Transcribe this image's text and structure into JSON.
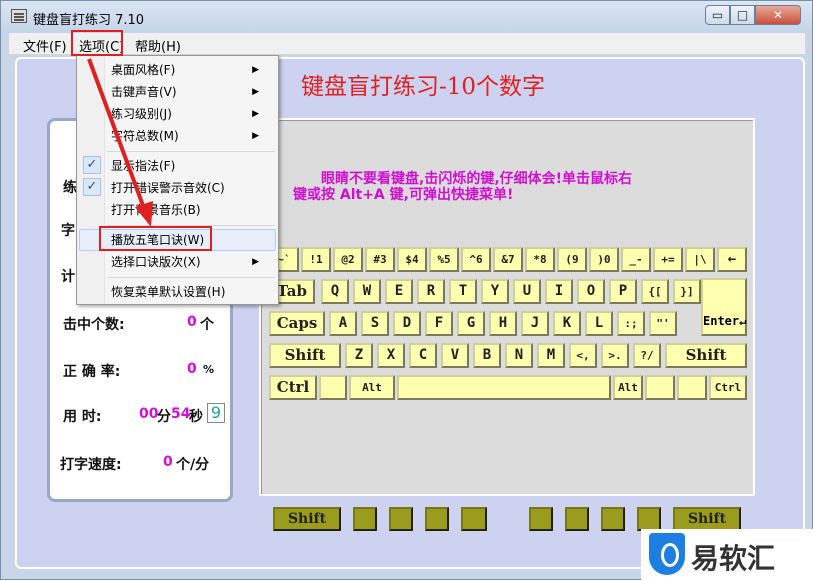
{
  "window": {
    "title": "键盘盲打练习 7.10",
    "controls": {
      "minimize": "▭",
      "maximize": "□",
      "close": "✕"
    }
  },
  "menubar": {
    "items": [
      {
        "label": "文件(F)"
      },
      {
        "label": "选项(C)"
      },
      {
        "label": "帮助(H)"
      }
    ]
  },
  "dropdown": {
    "items": [
      {
        "label": "桌面风格(F)",
        "submenu": true,
        "checked": false
      },
      {
        "label": "击键声音(V)",
        "submenu": true,
        "checked": false
      },
      {
        "label": "练习级别(J)",
        "submenu": true,
        "checked": false
      },
      {
        "label": "字符总数(M)",
        "submenu": true,
        "checked": false
      },
      {
        "label": "显示指法(F)",
        "submenu": false,
        "checked": true
      },
      {
        "label": "打开错误警示音效(C)",
        "submenu": false,
        "checked": true
      },
      {
        "label": "打开背景音乐(B)",
        "submenu": false,
        "checked": false
      },
      {
        "label": "播放五笔口诀(W)",
        "submenu": false,
        "checked": false
      },
      {
        "label": "选择口诀版次(X)",
        "submenu": true,
        "checked": false
      },
      {
        "label": "恢复菜单默认设置(H)",
        "submenu": false,
        "checked": false
      }
    ],
    "submenu_glyph": "▶",
    "check_glyph": "✓"
  },
  "heading": "键盘盲打练习-10个数字",
  "hint": {
    "line1": "眼睛不要看键盘,击闪烁的键,仔细体会!单击鼠标右",
    "line2": "键或按 Alt+A 键,可弹出快捷菜单!"
  },
  "stats": {
    "practice_label_partial": "练",
    "chars_label_partial": "字",
    "count_label_partial": "计",
    "hits_label": "击中个数:",
    "hits_value": "0",
    "hits_unit": "个",
    "accuracy_label": "正 确 率:",
    "accuracy_value": "0",
    "accuracy_unit": "%",
    "time_label": "用    时:",
    "time_min": "00",
    "time_min_unit": "分",
    "time_sec": "54",
    "time_sec_unit": "秒",
    "time_box": "9",
    "speed_label": "打字速度:",
    "speed_value": "0",
    "speed_unit": "个/分"
  },
  "keyboard": {
    "row1": [
      "~`",
      "!1",
      "@2",
      "#3",
      "$4",
      "%5",
      "^6",
      "&7",
      "*8",
      "(9",
      ")0",
      "_-",
      "+=",
      "|\\",
      "←"
    ],
    "row2": [
      "Tab",
      "Q",
      "W",
      "E",
      "R",
      "T",
      "Y",
      "U",
      "I",
      "O",
      "P",
      "{[",
      "}]"
    ],
    "row3": [
      "Caps",
      "A",
      "S",
      "D",
      "F",
      "G",
      "H",
      "J",
      "K",
      "L",
      ":;",
      "\"'"
    ],
    "enter": "Enter↵",
    "row4": [
      "Shift",
      "Z",
      "X",
      "C",
      "V",
      "B",
      "N",
      "M",
      "<,",
      ">.",
      "?/",
      "Shift"
    ],
    "row5": [
      "Ctrl",
      "",
      "Alt",
      "",
      "Alt",
      "",
      "",
      "Ctrl"
    ]
  },
  "finger_keys": {
    "left_shift": "Shift",
    "right_shift": "Shift"
  },
  "watermark": {
    "text": "易软汇"
  },
  "colors": {
    "accent_red": "#e02020",
    "magenta": "#d010d0",
    "key_yellow": "#ffffb0",
    "finger_olive": "#9b9b1e"
  }
}
